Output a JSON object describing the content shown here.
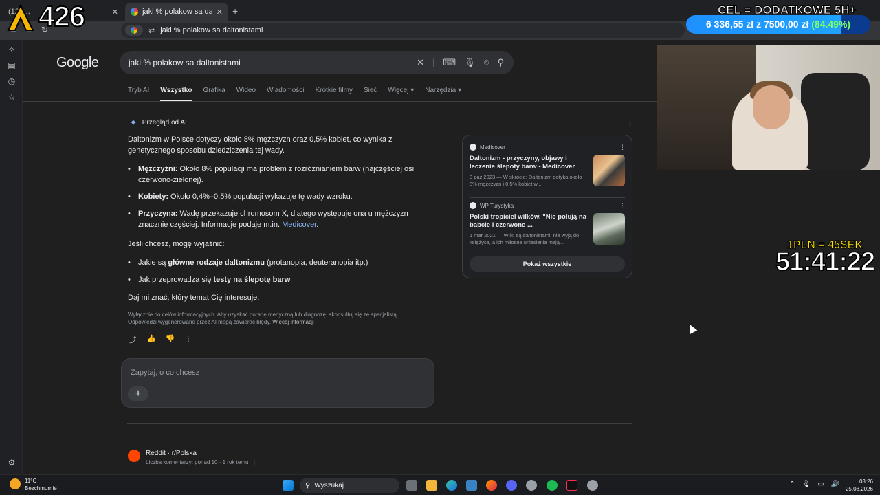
{
  "browser": {
    "tabs": [
      {
        "label": "(12) ...",
        "active": false
      },
      {
        "label": "jaki % polakow sa daltonistami",
        "active": true
      }
    ],
    "new_tab": "+",
    "address": "jaki % polakow sa daltonistami"
  },
  "google": {
    "logo": "Google",
    "query": "jaki % polakow sa daltonistami",
    "nav": [
      "Tryb AI",
      "Wszystko",
      "Grafika",
      "Wideo",
      "Wiadomości",
      "Krótkie filmy",
      "Sieć",
      "Więcej ▾",
      "Narzędzia ▾"
    ],
    "nav_active": "Wszystko"
  },
  "ai_overview": {
    "title": "Przegląd od AI",
    "intro": "Daltonizm w Polsce dotyczy około 8% mężczyzn oraz 0,5% kobiet, co wynika z genetycznego sposobu dziedziczenia tej wady.",
    "bullets": [
      {
        "bold": "Mężczyźni:",
        "text": " Około 8% populacji ma problem z rozróżnianiem barw (najczęściej osi czerwono-zielonej)."
      },
      {
        "bold": "Kobiety:",
        "text": " Około 0,4%–0,5% populacji wykazuje tę wady wzroku."
      },
      {
        "bold": "Przyczyna:",
        "text": " Wadę przekazuje chromosom X, dlatego występuje ona u mężczyzn znacznie częściej. Informacje podaje m.in. ",
        "link": "Medicover"
      }
    ],
    "followup": "Jeśli chcesz, mogę wyjaśnić:",
    "options": [
      {
        "pre": "Jakie są ",
        "bold": "główne rodzaje daltonizmu",
        "post": " (protanopia, deuteranopia itp.)"
      },
      {
        "pre": "Jak przeprowadza się ",
        "bold": "testy na ślepotę barw",
        "post": ""
      }
    ],
    "closing": "Daj mi znać, który temat Cię interesuje.",
    "disclaimer": "Wyłącznie do celów informacyjnych. Aby uzyskać poradę medyczną lub diagnozę, skonsultuj się ze specjalistą. Odpowiedzi wygenerowane przez AI mogą zawierać błędy.",
    "disclaimer_link": "Więcej informacji"
  },
  "ask_box": {
    "placeholder": "Zapytaj, o co chcesz",
    "plus": "+"
  },
  "sources": [
    {
      "site": "Medicover",
      "title": "Daltonizm - przyczyny, objawy i leczenie ślepoty barw - Medicover",
      "snippet": "3 paź 2023 — W skrócie: Daltonizm dotyka około 8% mężczyzn i 0,5% kobiet w..."
    },
    {
      "site": "WP Turystyka",
      "title": "Polski tropiciel wilków. \"Nie polują na babcie i czerwone ...",
      "snippet": "1 mar 2021 — Wilki są daltonistami, nie wyją do księżyca, a ich miłosne uniesienia mają..."
    }
  ],
  "show_all": "Pokaż wszystkie",
  "result": {
    "source": "Reddit · r/Polska",
    "meta": "Liczba komentarzy: ponad 10 · 1 rok temu"
  },
  "overlay": {
    "counter": "426",
    "goal_title": "CEL = DODATKOWE 5H+",
    "goal_current": "6 336,55 zł",
    "goal_sep": "z",
    "goal_target": "7500,00 zł",
    "goal_pct": "(84.49%)",
    "goal_fraction": 0.8449,
    "rate": "1PLN = 45SEK",
    "timer": "51:41:22"
  },
  "taskbar": {
    "temp": "11°C",
    "weather": "Bezchmurnie",
    "search": "Wyszukaj",
    "time": "03:26",
    "date": "25.08.2026"
  }
}
